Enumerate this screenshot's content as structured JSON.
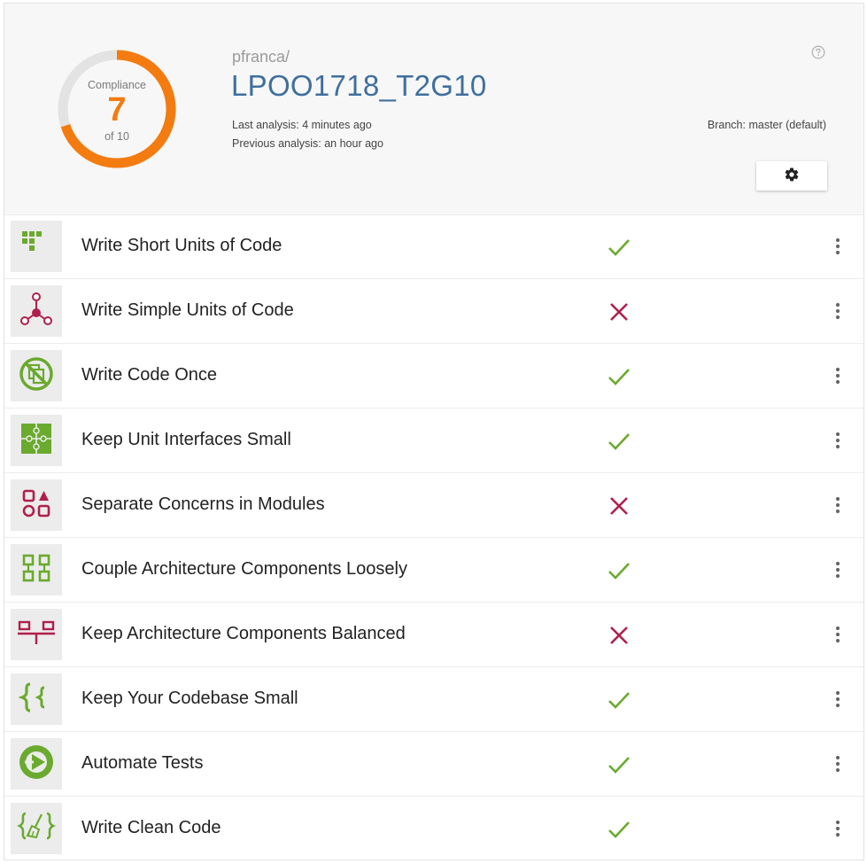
{
  "header": {
    "compliance_label": "Compliance",
    "score": "7",
    "score_of": "of 10",
    "score_value": 7,
    "score_max": 10,
    "owner": "pfranca/",
    "repo": "LPOO1718_T2G10",
    "last_analysis": "Last analysis: 4 minutes ago",
    "previous_analysis": "Previous analysis: an hour ago",
    "branch": "Branch: master (default)",
    "help_icon": "help-circle-icon",
    "settings_icon": "gear-icon"
  },
  "colors": {
    "accent": "#f47b10",
    "repo_link": "#3f6f9e",
    "pass": "#6aaa2e",
    "fail": "#b01f4b"
  },
  "guidelines": [
    {
      "label": "Write Short Units of Code",
      "status": "pass",
      "icon": "short-units-icon"
    },
    {
      "label": "Write Simple Units of Code",
      "status": "fail",
      "icon": "simple-units-icon"
    },
    {
      "label": "Write Code Once",
      "status": "pass",
      "icon": "no-duplication-icon"
    },
    {
      "label": "Keep Unit Interfaces Small",
      "status": "pass",
      "icon": "puzzle-icon"
    },
    {
      "label": "Separate Concerns in Modules",
      "status": "fail",
      "icon": "modules-icon"
    },
    {
      "label": "Couple Architecture Components Loosely",
      "status": "pass",
      "icon": "components-icon"
    },
    {
      "label": "Keep Architecture Components Balanced",
      "status": "fail",
      "icon": "balance-icon"
    },
    {
      "label": "Keep Your Codebase Small",
      "status": "pass",
      "icon": "braces-icon"
    },
    {
      "label": "Automate Tests",
      "status": "pass",
      "icon": "play-icon"
    },
    {
      "label": "Write Clean Code",
      "status": "pass",
      "icon": "broom-braces-icon"
    }
  ]
}
